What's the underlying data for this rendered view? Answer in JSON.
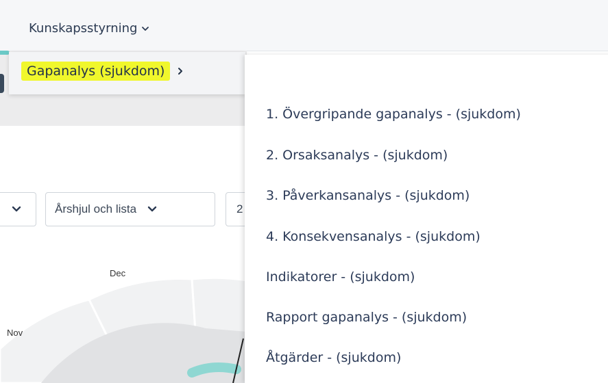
{
  "nav": {
    "menu_label": "Kunskapsstyrning",
    "submenu_item_label": "Gapanalys (sjukdom)"
  },
  "filters": {
    "first_value": "",
    "view_select_value": "Årshjul och lista",
    "year_select_value": "2"
  },
  "wheel": {
    "months": [
      "Dec",
      "Nov"
    ]
  },
  "submenu_items": [
    "1. Övergripande gapanalys - (sjukdom)",
    "2. Orsaksanalys - (sjukdom)",
    "3. Påverkansanalys - (sjukdom)",
    "4. Konsekvensanalys - (sjukdom)",
    "Indikatorer - (sjukdom)",
    "Rapport gapanalys - (sjukdom)",
    "Åtgärder - (sjukdom)"
  ],
  "colors": {
    "highlight": "#f0f72c",
    "accent_teal": "#6bc9c6",
    "text_dark": "#2c3b58"
  }
}
